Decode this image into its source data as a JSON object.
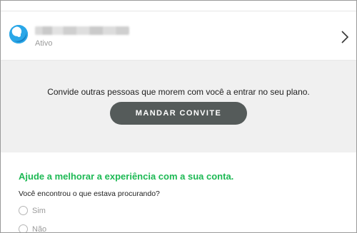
{
  "member": {
    "avatar_icon": "avatar-icon",
    "status": "Ativo",
    "chevron_icon": "chevron-right-icon"
  },
  "invite": {
    "text": "Convide outras pessoas que morem com você a entrar no seu plano.",
    "button_label": "MANDAR CONVITE"
  },
  "feedback": {
    "title": "Ajude a melhorar a experiência com a sua conta.",
    "question": "Você encontrou o que estava procurando?",
    "options": [
      {
        "label": "Sim",
        "selected": false
      },
      {
        "label": "Não",
        "selected": false
      }
    ]
  },
  "colors": {
    "accent": "#1db954",
    "button_bg": "#555b5a",
    "band_bg": "#f0f0f0"
  }
}
